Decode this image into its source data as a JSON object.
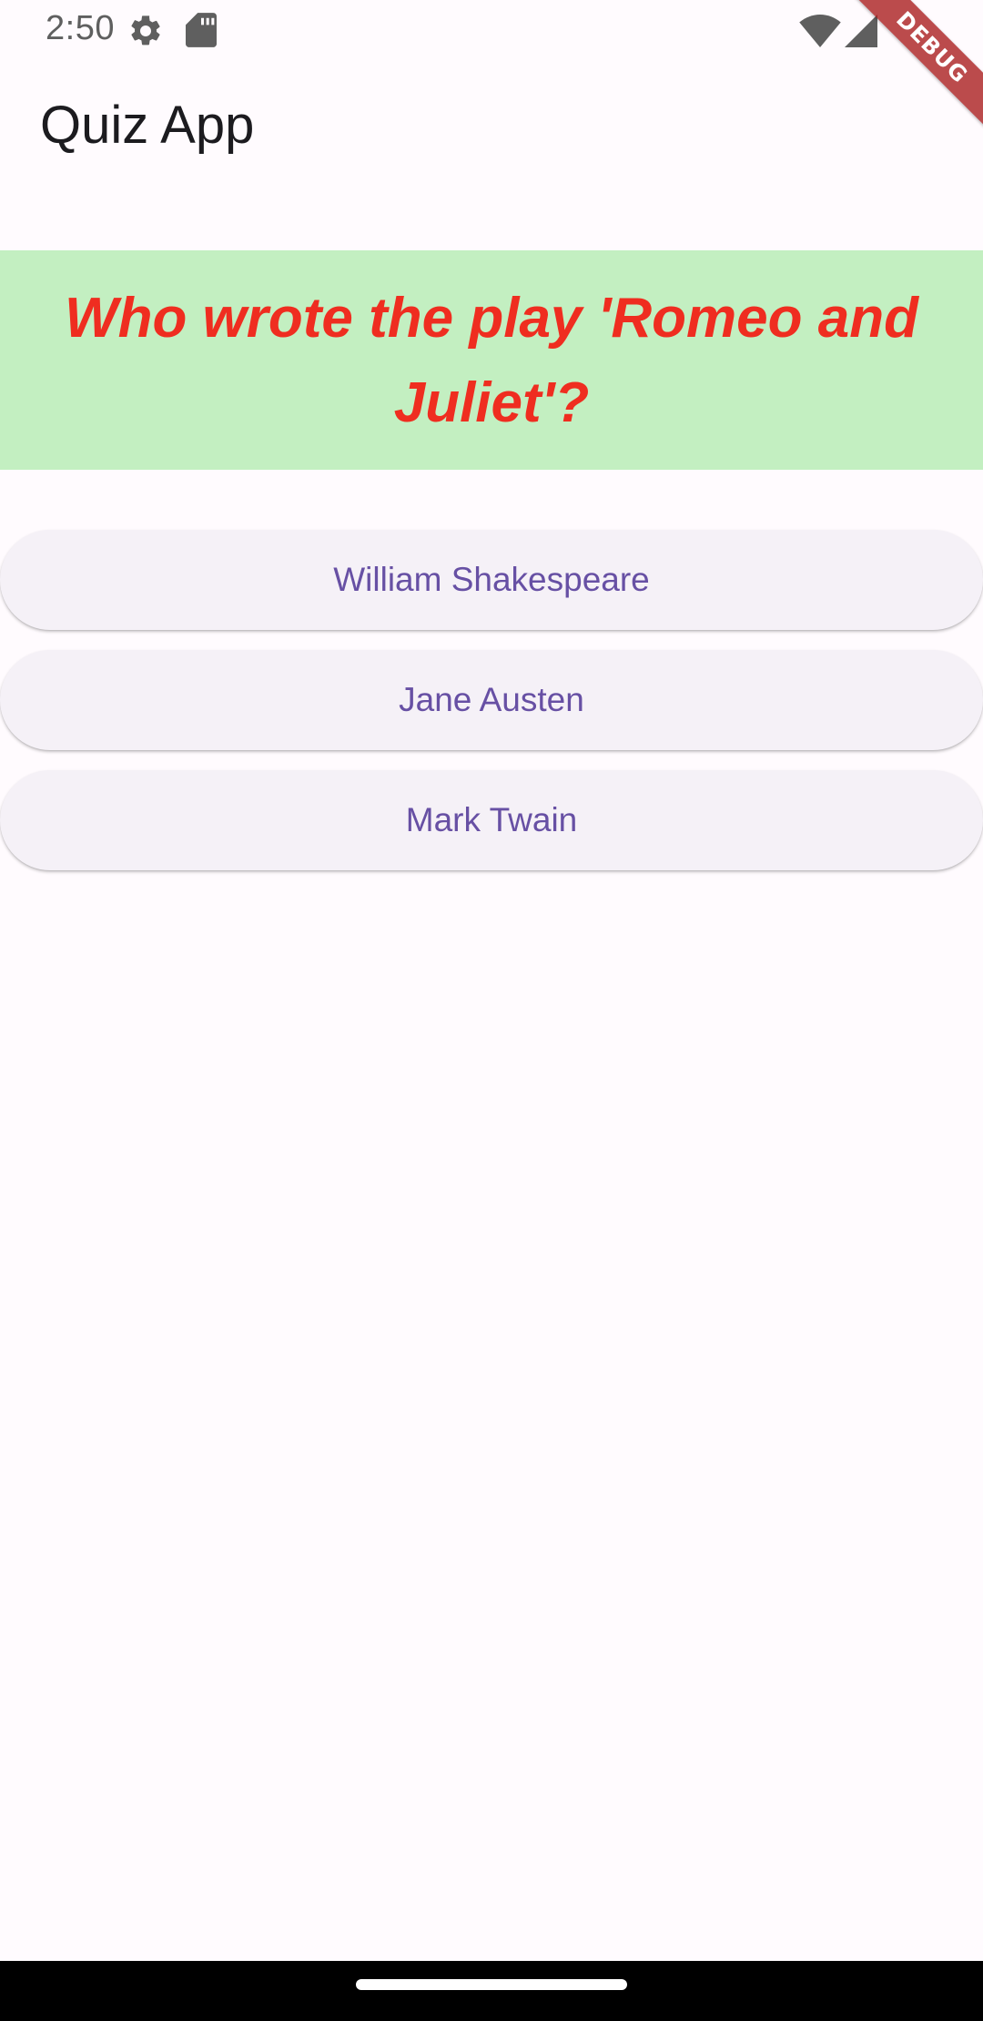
{
  "status_bar": {
    "time": "2:50",
    "icons": [
      "settings-gear-icon",
      "sd-card-icon",
      "wifi-icon",
      "cellular-signal-icon"
    ]
  },
  "debug_banner": {
    "label": "DEBUG"
  },
  "app_bar": {
    "title": "Quiz App"
  },
  "question": {
    "text": "Who wrote the play 'Romeo and Juliet'?",
    "background_color": "#c3efc1",
    "text_color": "#ef2d20"
  },
  "answers": [
    {
      "label": "William Shakespeare"
    },
    {
      "label": "Jane Austen"
    },
    {
      "label": "Mark Twain"
    }
  ],
  "colors": {
    "background": "#fffbfe",
    "button_background": "#f5f1f7",
    "button_text": "#6750a4"
  }
}
